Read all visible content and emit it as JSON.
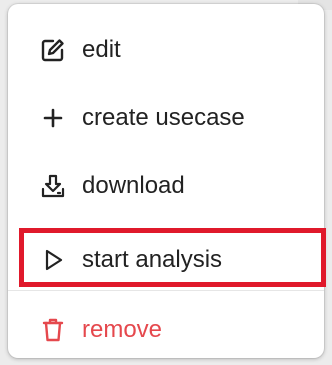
{
  "menu": {
    "items": [
      {
        "id": "edit",
        "label": "edit",
        "icon": "edit-icon"
      },
      {
        "id": "create",
        "label": "create usecase",
        "icon": "plus-icon"
      },
      {
        "id": "download",
        "label": "download",
        "icon": "download-icon"
      },
      {
        "id": "analysis",
        "label": "start analysis",
        "icon": "play-icon",
        "highlighted": true
      },
      {
        "id": "remove",
        "label": "remove",
        "icon": "trash-icon",
        "danger": true
      }
    ]
  },
  "colors": {
    "text": "#222222",
    "danger": "#e5484d",
    "highlight_border": "#e0192b",
    "background": "#ececec",
    "menu_background": "#ffffff"
  }
}
